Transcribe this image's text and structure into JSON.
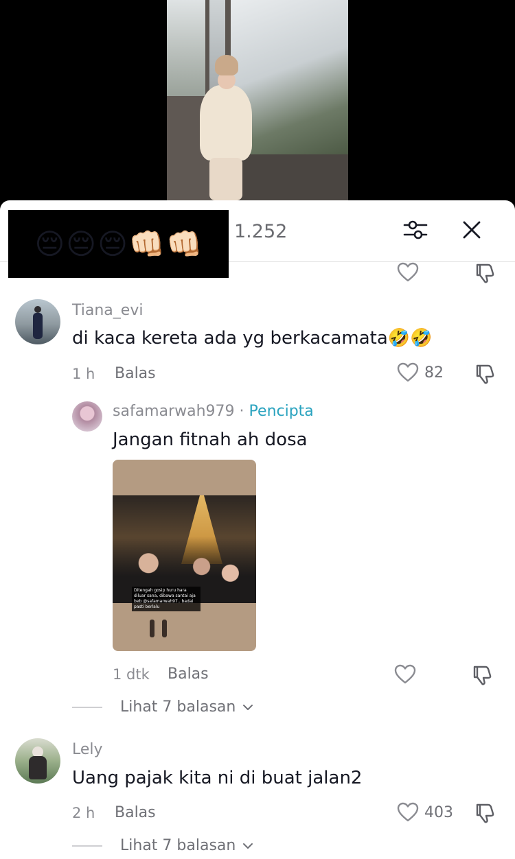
{
  "header": {
    "emojis": [
      "😔",
      "😔",
      "😔",
      "👊🏻",
      "👊🏻"
    ],
    "comment_count": "1.252"
  },
  "comments": [
    {
      "username": "Tiana_evi",
      "text": "di kaca kereta ada yg berkacamata",
      "text_emoji": "🤣🤣",
      "time": "1 h",
      "reply_label": "Balas",
      "likes": "82"
    },
    {
      "username": "safamarwah979",
      "creator_separator": "·",
      "creator_label": "Pencipta",
      "text": "Jangan fitnah ah dosa",
      "image_caption": "Ditengah gosip huru hara diluar sana, dibawa santai aja beb @safamarwah97.. badai pasti berlalu",
      "time": "1 dtk",
      "reply_label": "Balas",
      "view_replies": "Lihat 7 balasan"
    },
    {
      "username": "Lely",
      "text": "Uang pajak kita ni di buat jalan2",
      "time": "2 h",
      "reply_label": "Balas",
      "likes": "403",
      "view_replies": "Lihat 7 balasan"
    }
  ],
  "colors": {
    "creator": "#2aa3bf",
    "secondary_text": "#8a8b91",
    "primary_text": "#161823"
  },
  "icons": {
    "filter": "sliders-icon",
    "close": "close-icon",
    "like": "heart-outline-icon",
    "dislike": "thumbs-down-icon",
    "expand": "chevron-down-icon"
  }
}
